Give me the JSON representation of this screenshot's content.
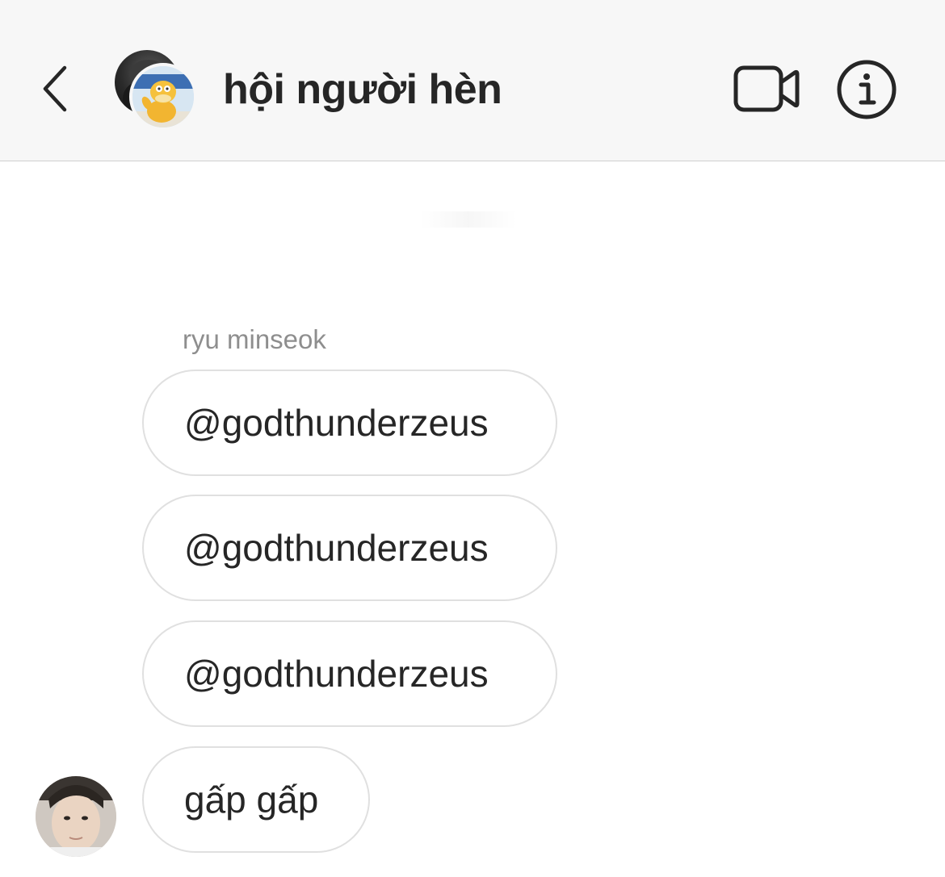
{
  "header": {
    "title": "hội người hèn",
    "back_icon": "chevron-left-icon",
    "video_icon": "video-camera-icon",
    "info_icon": "info-icon"
  },
  "thread": {
    "sender_name": "ryu minseok",
    "messages": [
      {
        "text": "@godthunderzeus"
      },
      {
        "text": "@godthunderzeus"
      },
      {
        "text": "@godthunderzeus"
      },
      {
        "text": "gấp gấp"
      }
    ]
  },
  "colors": {
    "header_bg": "#f7f7f7",
    "text": "#262626",
    "secondary_text": "#8e8e8e",
    "bubble_border": "#e0e0e0"
  }
}
